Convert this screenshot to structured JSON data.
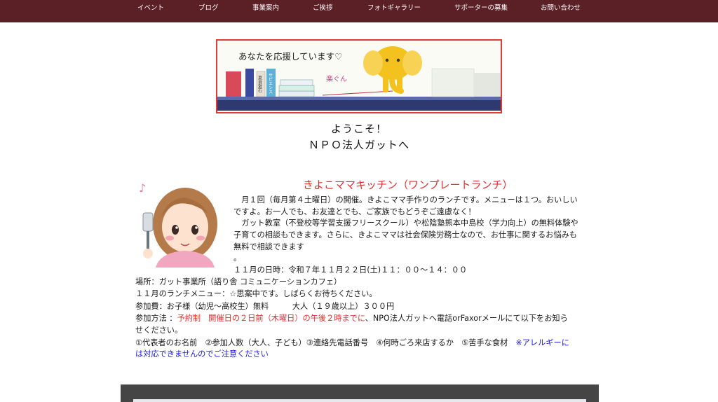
{
  "nav": {
    "items": [
      "イベント",
      "ブログ",
      "事業案内",
      "ご挨拶",
      "フォトギャラリー",
      "サポーターの募集",
      "お問い合わせ"
    ]
  },
  "banner": {
    "text": "あなたを応援しています♡",
    "book_labels": [
      "夏目漱石",
      "サピエンス"
    ],
    "signature": "楽ぐん"
  },
  "welcome": {
    "line1": "ようこそ！",
    "line2": "ＮＰＯ法人ガットへ"
  },
  "section": {
    "title": "きよこママキッチン（ワンプレートランチ）",
    "lines": [
      "　月１回（毎月第４土曜日）の開催。きよこママ手作りのランチです。メニューは１つ。おいしい",
      "ですよ。お一人でも、お友達とでも、ご家族でもどうぞご遠慮なく！",
      "　ガット教室（不登校等学習支援フリースクール）や松陰塾熊本中島校（学力向上）の無料体験や",
      "子育ての相談もできます。さらに、きよこママは社会保険労務士なので、お仕事に関するお悩みも",
      "無料で相談できます",
      "。",
      "１１月の日時：令和７年１１月２２日(土)１１：００〜１４：００"
    ],
    "place": "場所：ガット事業所（語り舎 コミュニケーションカフェ）",
    "menu": "１１月のランチメニュー：☆思案中です。しばらくお待ちください。",
    "fee": "参加費：お子様（幼児〜高校生）無料　　　大人（１９歳以上）３００円",
    "method_prefix": "参加方法 ：",
    "method_red": "予約制　開催日の２日前（木曜日）の午後２時までに",
    "method_suffix": "、NPO法人ガットへ電話orFaxorメールにて以下をお知ら",
    "method_line2": "せください。",
    "items_line": "①代表者のお名前　②参加人数（大人、子ども）③連絡先電話番号　④何時ごろ来店するか　⑤苦手な食材　",
    "allergy_part1": "※アレルギーに",
    "allergy_part2": "は対応できませんのでご注意ください"
  }
}
